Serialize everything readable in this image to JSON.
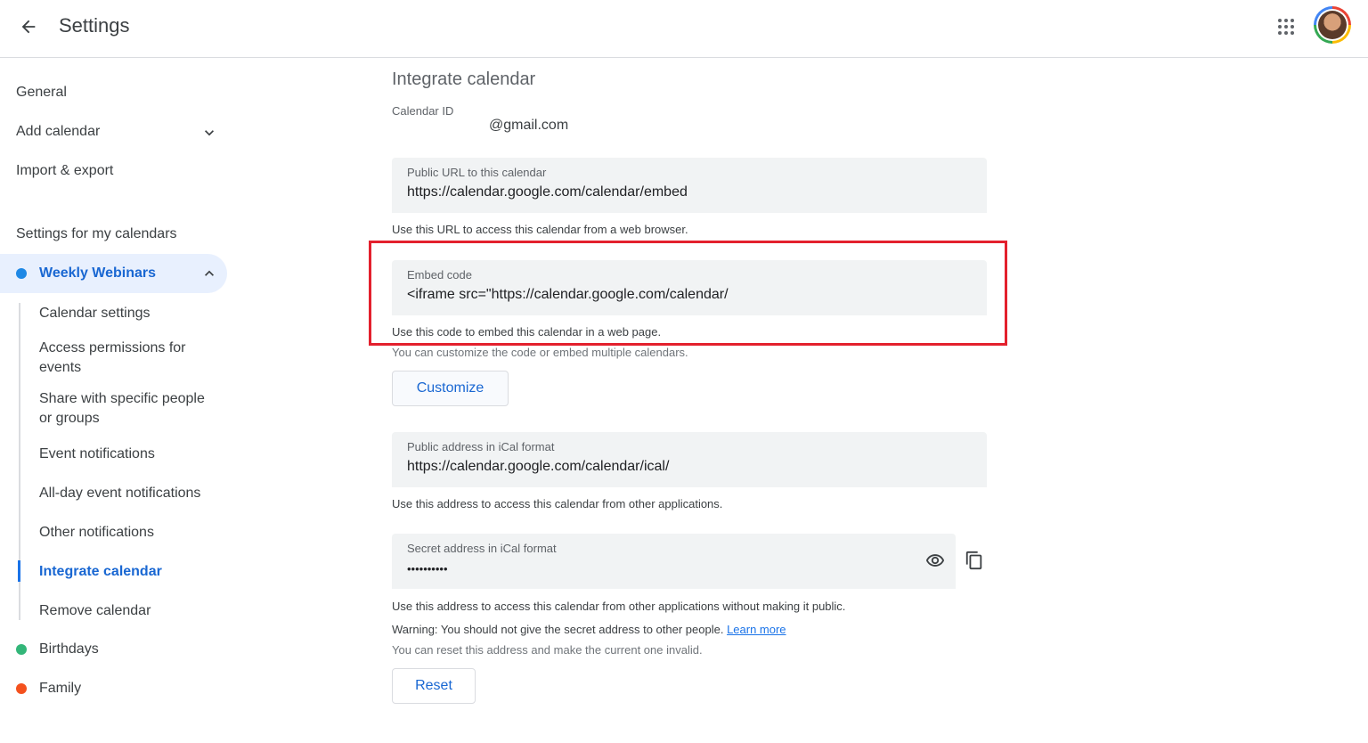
{
  "header": {
    "title": "Settings",
    "back_icon": "arrow-back-icon",
    "apps_icon": "apps-grid-icon"
  },
  "sidebar": {
    "general": "General",
    "add_calendar": "Add calendar",
    "import_export": "Import & export",
    "section_title": "Settings for my calendars",
    "calendars": [
      {
        "name": "Weekly Webinars",
        "color": "#1e88e5"
      },
      {
        "name": "Birthdays",
        "color": "#33b679"
      },
      {
        "name": "Family",
        "color": "#f4511e"
      }
    ],
    "sub_items": [
      "Calendar settings",
      "Access permissions for events",
      "Share with specific people or groups",
      "Event notifications",
      "All-day event notifications",
      "Other notifications",
      "Integrate calendar",
      "Remove calendar"
    ],
    "active_sub_item": "Integrate calendar"
  },
  "main": {
    "title": "Integrate calendar",
    "calendar_id_label": "Calendar ID",
    "calendar_id_value": "@gmail.com",
    "public_url": {
      "label": "Public URL to this calendar",
      "value": "https://calendar.google.com/calendar/embed",
      "help": "Use this URL to access this calendar from a web browser."
    },
    "embed": {
      "label": "Embed code",
      "value": "<iframe src=\"https://calendar.google.com/calendar/",
      "help": "Use this code to embed this calendar in a web page.",
      "help2": "You can customize the code or embed multiple calendars."
    },
    "customize_button": "Customize",
    "ical_public": {
      "label": "Public address in iCal format",
      "value": "https://calendar.google.com/calendar/ical/",
      "help": "Use this address to access this calendar from other applications."
    },
    "ical_secret": {
      "label": "Secret address in iCal format",
      "value": "••••••••••",
      "help": "Use this address to access this calendar from other applications without making it public.",
      "warning": "Warning: You should not give the secret address to other people.",
      "learn_more": "Learn more",
      "reset_help": "You can reset this address and make the current one invalid."
    },
    "reset_button": "Reset",
    "highlight_color": "#e3202d"
  }
}
